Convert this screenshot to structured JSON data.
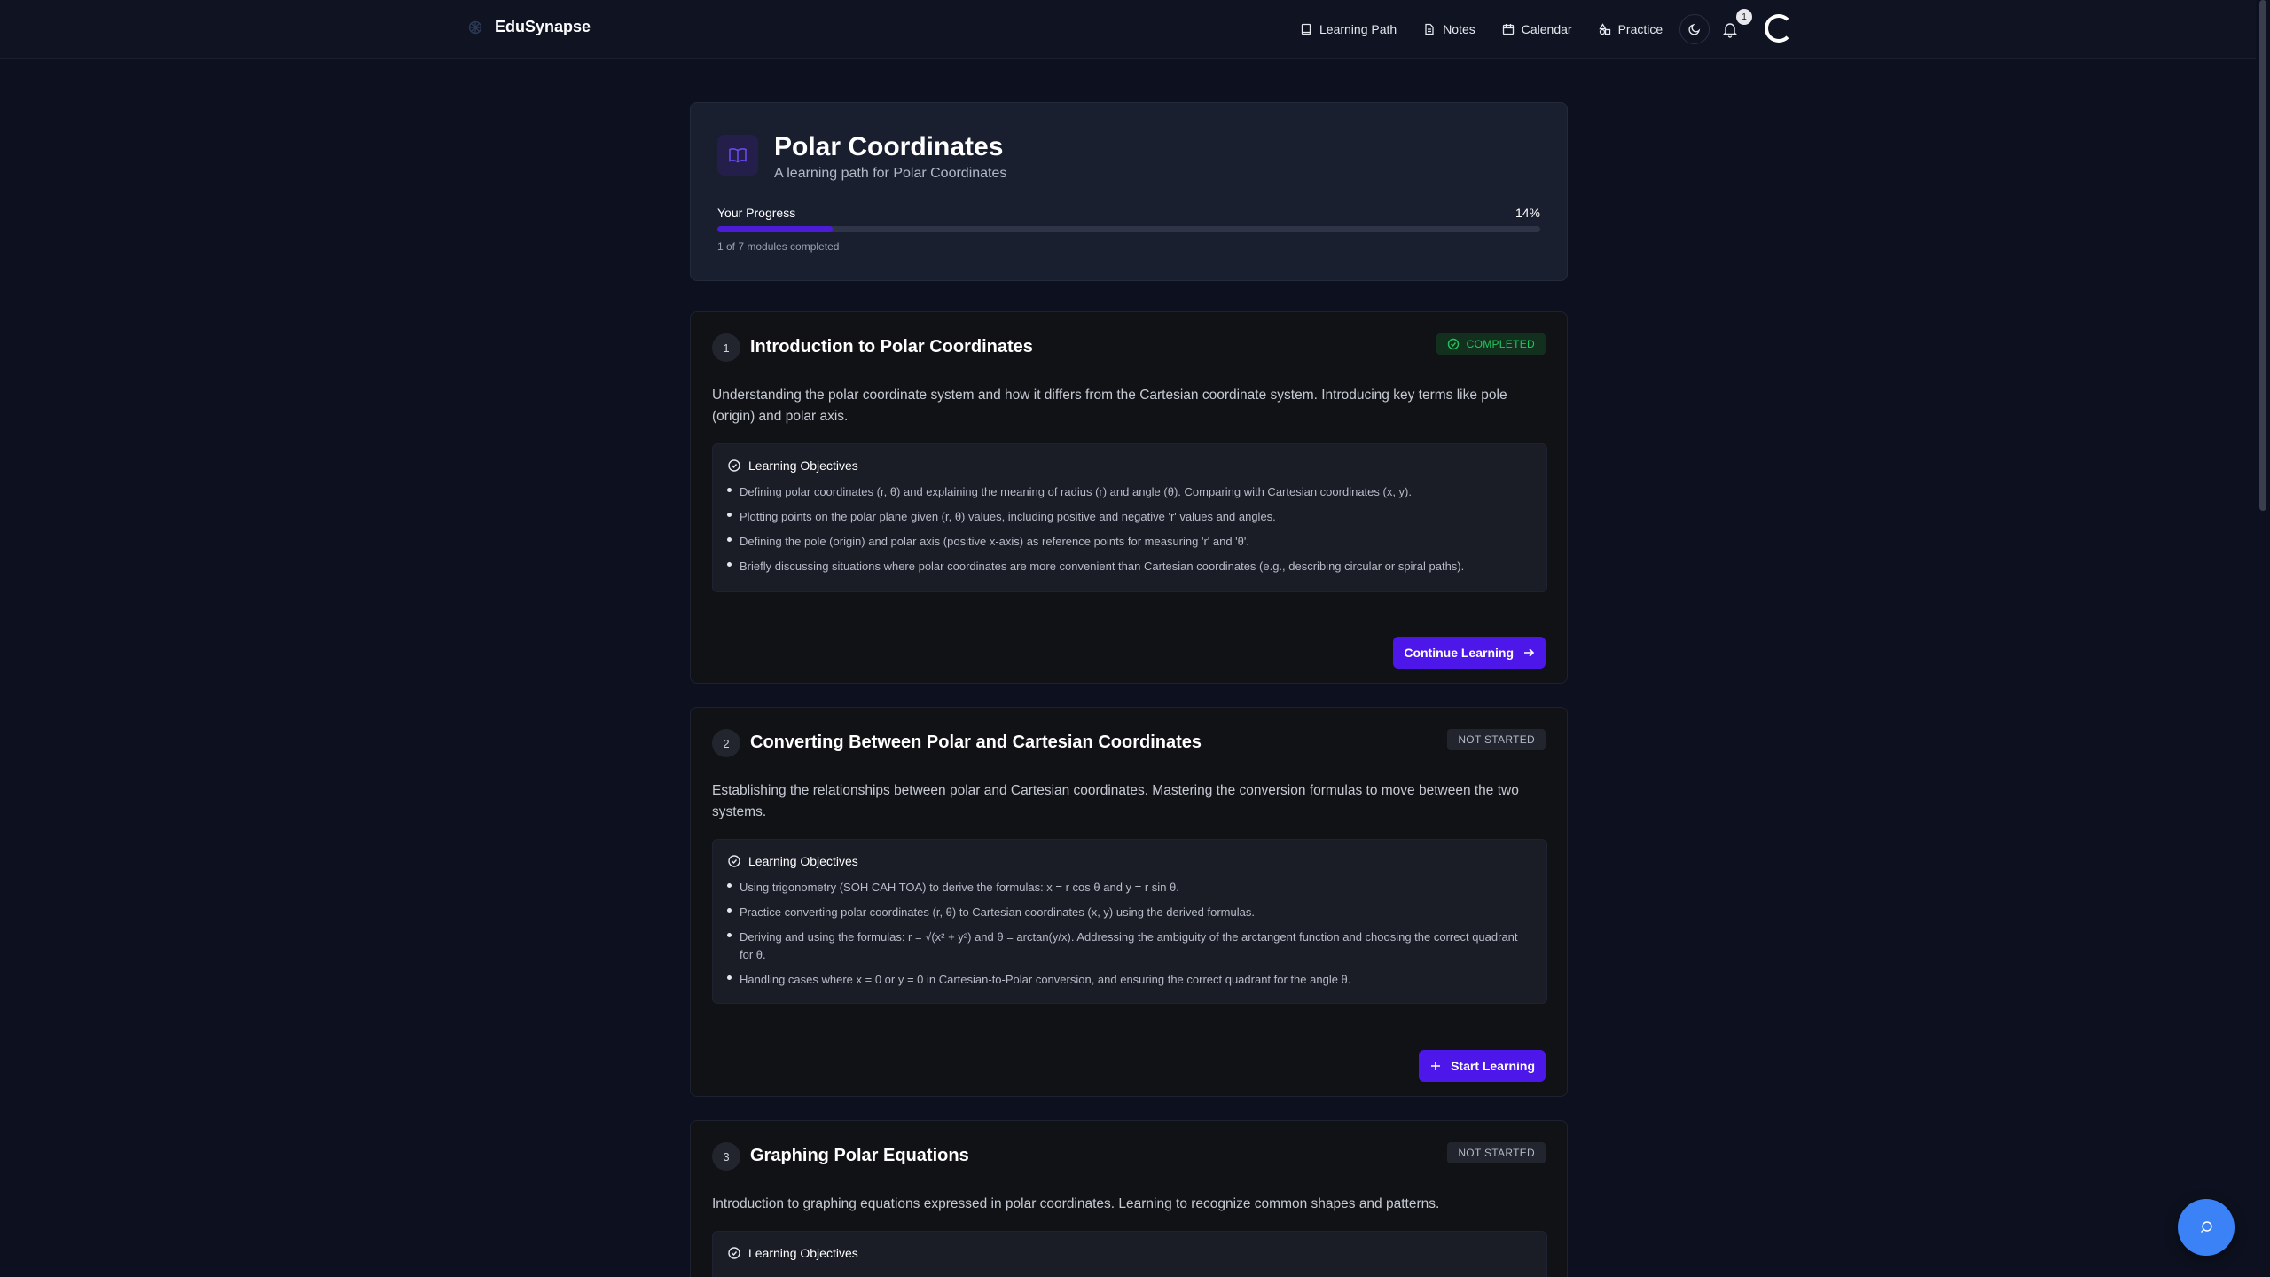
{
  "app": {
    "name": "EduSynapse"
  },
  "nav": {
    "items": [
      {
        "label": "Learning Path",
        "icon": "book-icon"
      },
      {
        "label": "Notes",
        "icon": "file-icon"
      },
      {
        "label": "Calendar",
        "icon": "calendar-icon"
      },
      {
        "label": "Practice",
        "icon": "shapes-icon"
      }
    ],
    "notification_count": "1"
  },
  "path": {
    "title": "Polar Coordinates",
    "subtitle": "A learning path for Polar Coordinates",
    "progress_label": "Your Progress",
    "progress_value": 14,
    "progress_text": "14%",
    "progress_meta": "1 of 7 modules completed"
  },
  "modules": [
    {
      "number": "1",
      "title": "Introduction to Polar Coordinates",
      "status": "COMPLETED",
      "description": "Understanding the polar coordinate system and how it differs from the Cartesian coordinate system. Introducing key terms like pole (origin) and polar axis.",
      "objectives_title": "Learning Objectives",
      "objectives": [
        "Defining polar coordinates (r, θ) and explaining the meaning of radius (r) and angle (θ). Comparing with Cartesian coordinates (x, y).",
        "Plotting points on the polar plane given (r, θ) values, including positive and negative 'r' values and angles.",
        "Defining the pole (origin) and polar axis (positive x-axis) as reference points for measuring 'r' and 'θ'.",
        "Briefly discussing situations where polar coordinates are more convenient than Cartesian coordinates (e.g., describing circular or spiral paths)."
      ],
      "cta": "Continue Learning"
    },
    {
      "number": "2",
      "title": "Converting Between Polar and Cartesian Coordinates",
      "status": "NOT STARTED",
      "description": "Establishing the relationships between polar and Cartesian coordinates. Mastering the conversion formulas to move between the two systems.",
      "objectives_title": "Learning Objectives",
      "objectives": [
        "Using trigonometry (SOH CAH TOA) to derive the formulas: x = r cos θ and y = r sin θ.",
        "Practice converting polar coordinates (r, θ) to Cartesian coordinates (x, y) using the derived formulas.",
        "Deriving and using the formulas: r = √(x² + y²) and θ = arctan(y/x). Addressing the ambiguity of the arctangent function and choosing the correct quadrant for θ.",
        "Handling cases where x = 0 or y = 0 in Cartesian-to-Polar conversion, and ensuring the correct quadrant for the angle θ."
      ],
      "cta": "Start Learning"
    },
    {
      "number": "3",
      "title": "Graphing Polar Equations",
      "status": "NOT STARTED",
      "description": "Introduction to graphing equations expressed in polar coordinates. Learning to recognize common shapes and patterns.",
      "objectives_title": "Learning Objectives"
    }
  ],
  "colors": {
    "accent": "#4c17e8",
    "progress": "#4b1dd6",
    "completed": "#22c55e",
    "fab": "#3b82f6"
  }
}
